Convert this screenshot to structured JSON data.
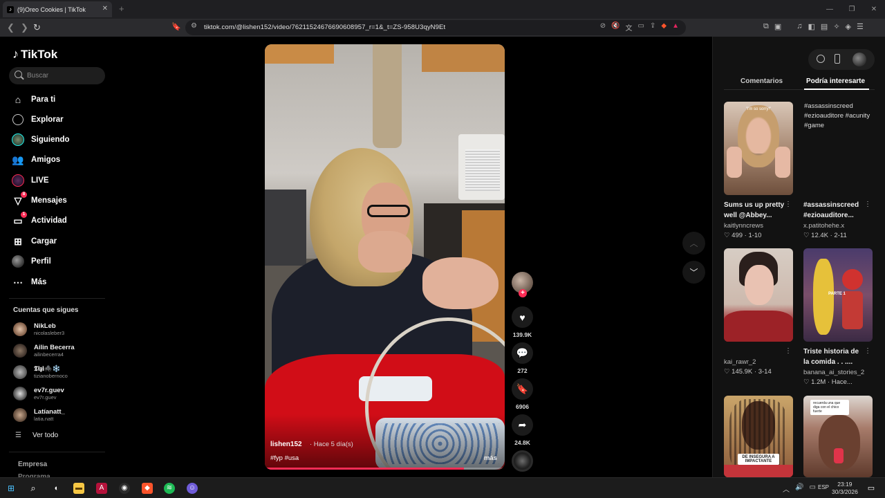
{
  "browser": {
    "tab_title": "(9)Oreo Cookies | TikTok",
    "tab_close": "✕",
    "new_tab": "+",
    "url": "tiktok.com/@lishen152/video/76211524676690608957_r=1&_t=ZS-958U3qyN9Et",
    "window_controls": [
      "—",
      "❐",
      "✕"
    ]
  },
  "sidebar": {
    "logo": "TikTok",
    "search_placeholder": "Buscar",
    "nav": [
      {
        "label": "Para ti",
        "icon": "home-icon"
      },
      {
        "label": "Explorar",
        "icon": "compass-icon"
      },
      {
        "label": "Siguiendo",
        "icon": "following-avatar-icon"
      },
      {
        "label": "Amigos",
        "icon": "friends-icon"
      },
      {
        "label": "LIVE",
        "icon": "live-icon"
      },
      {
        "label": "Mensajes",
        "icon": "messages-icon",
        "badge": "8"
      },
      {
        "label": "Actividad",
        "icon": "activity-icon",
        "badge": "1"
      },
      {
        "label": "Cargar",
        "icon": "upload-icon"
      },
      {
        "label": "Perfil",
        "icon": "profile-avatar-icon"
      },
      {
        "label": "Más",
        "icon": "more-icon"
      }
    ],
    "following_title": "Cuentas que sigues",
    "accounts": [
      {
        "name": "NikLeb",
        "handle": "nicolasleber3"
      },
      {
        "name": "Ailin Becerra",
        "handle": "ailinbecerra4"
      },
      {
        "name": "𝕿𝖎𝖟𝖎🕷️❄️",
        "handle": "tizianobernoco"
      },
      {
        "name": "ev7r.guev",
        "handle": "ev7r.guev"
      },
      {
        "name": "Latíanatt_",
        "handle": "latia.natt"
      }
    ],
    "see_all": "Ver todo",
    "footer": [
      "Empresa",
      "Programa"
    ]
  },
  "video": {
    "author": "lishen152",
    "time": "· Hace 5 día(s)",
    "tags": "#fyp #usa",
    "more": "más",
    "progress": 0.83
  },
  "actions": {
    "likes": "139.9K",
    "comments": "272",
    "saves": "6906",
    "shares": "24.8K"
  },
  "right_panel": {
    "tabs": [
      "Comentarios",
      "Podría interesarte"
    ],
    "active_tab": "Podría interesarte",
    "cards": [
      {
        "title": "Sums us up pretty well @Abbey...",
        "user": "kaitlynncrews",
        "likes": "♡ 499 · 1-10",
        "thumb_caption": "\"i'm so sorry!\""
      },
      {
        "title": "#assassinscreed #ezioauditore...",
        "user": "x.patitohehe.x",
        "likes": "♡ 12.4K · 2-11",
        "alt_text": "#assassinscreed #ezioauditore #acunity #game"
      },
      {
        "title": "",
        "user": "kai_rawr_2",
        "likes": "♡ 145.9K · 3-14"
      },
      {
        "title": "Triste historia de la comida . . ....",
        "user": "banana_ai_stories_2",
        "likes": "♡ 1.2M · Hace...",
        "thumb_caption": "PARTE 1"
      },
      {
        "title": "",
        "user": "",
        "likes": "",
        "thumb_caption": "DE INSEGURA A IMPACTANTE"
      },
      {
        "title": "",
        "user": "",
        "likes": "",
        "thumb_caption": "recuerda una que diga con el chico fuerte"
      }
    ]
  },
  "taskbar": {
    "lang": "ESP",
    "time": "23:19",
    "date": "30/3/2026"
  },
  "colors": {
    "accent": "#fe2c55",
    "background": "#000000",
    "panel": "#121212"
  }
}
